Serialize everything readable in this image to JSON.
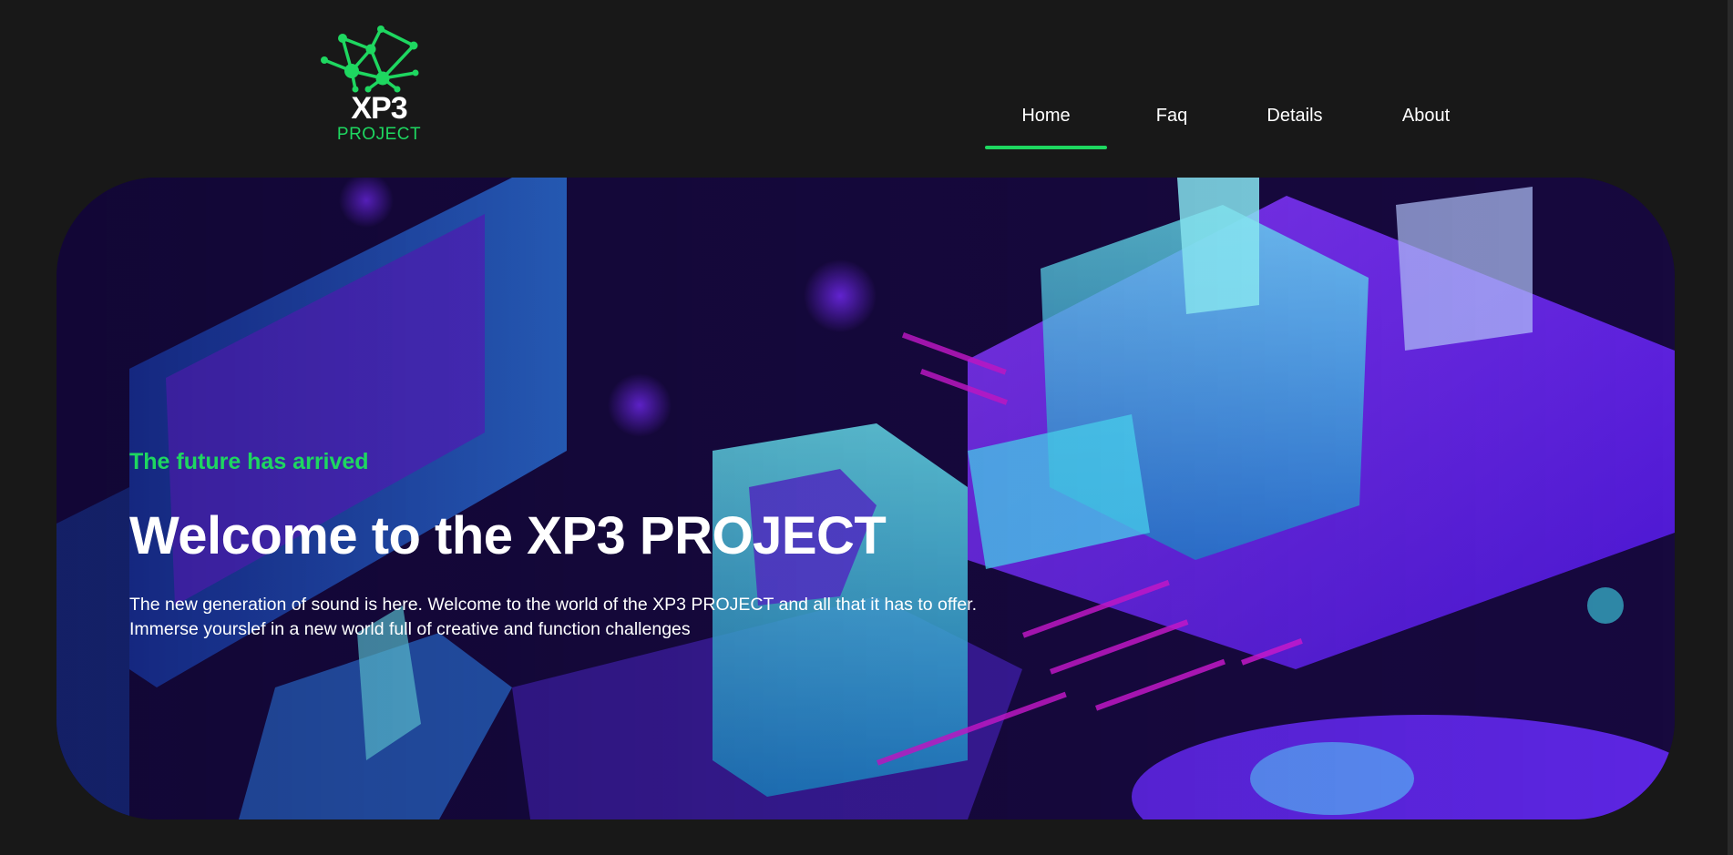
{
  "brand": {
    "name": "XP3",
    "subtitle": "PROJECT",
    "accent_color": "#1ed760",
    "logo_icon": "network-nodes-icon"
  },
  "nav": {
    "items": [
      {
        "label": "Home",
        "active": true
      },
      {
        "label": "Faq",
        "active": false
      },
      {
        "label": "Details",
        "active": false
      },
      {
        "label": "About",
        "active": false
      }
    ]
  },
  "hero": {
    "tagline": "The future has arrived",
    "title": "Welcome to the XP3 PROJECT",
    "description_lines": [
      "The new generation of sound is here. Welcome to the world of the XP3 PROJECT and all that it has to offer.",
      "Immerse yourslef in a new world full of creative and function challenges"
    ],
    "background_colors": [
      "#15093a",
      "#6a2bff",
      "#3fe0f0",
      "#d21bd6"
    ]
  }
}
